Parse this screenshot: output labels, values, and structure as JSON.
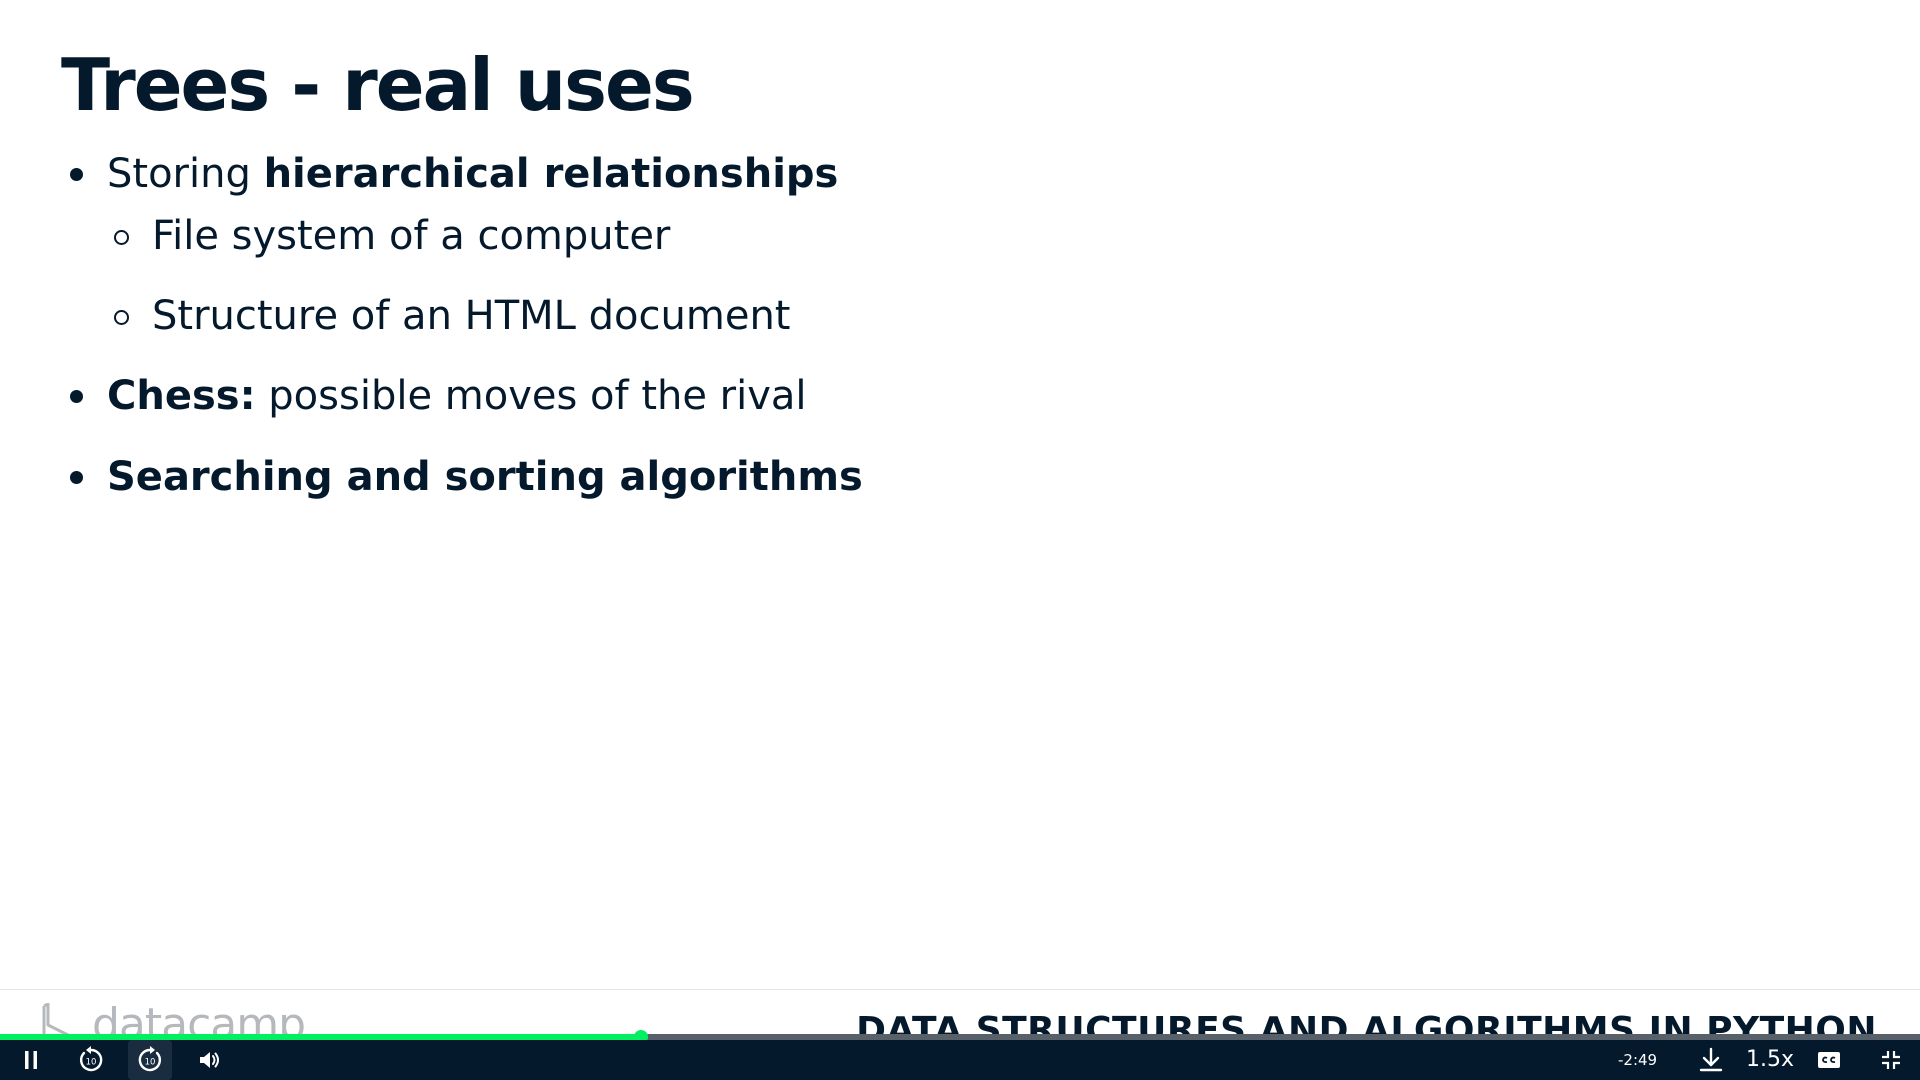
{
  "slide": {
    "title": "Trees - real uses",
    "bullets": [
      {
        "normal": "Storing ",
        "bold": "hierarchical relationships"
      },
      {
        "text": "File system of a computer"
      },
      {
        "text": "Structure of an HTML document"
      },
      {
        "bold": "Chess:",
        "normal": " possible moves of the rival"
      },
      {
        "bold": "Searching and sorting algorithms"
      }
    ]
  },
  "footer": {
    "logo_text": "datacamp",
    "course_title": "DATA STRUCTURES AND ALGORITHMS IN PYTHON"
  },
  "player": {
    "progress_fraction": 0.334,
    "time_remaining": "-2:49",
    "speed": "1.5x",
    "icons": [
      "pause-icon",
      "rewind-10-icon",
      "forward-10-icon",
      "volume-icon",
      "download-icon",
      "captions-icon",
      "exit-fullscreen-icon"
    ],
    "accent_color": "#03ef62",
    "bar_color": "#05192d"
  }
}
